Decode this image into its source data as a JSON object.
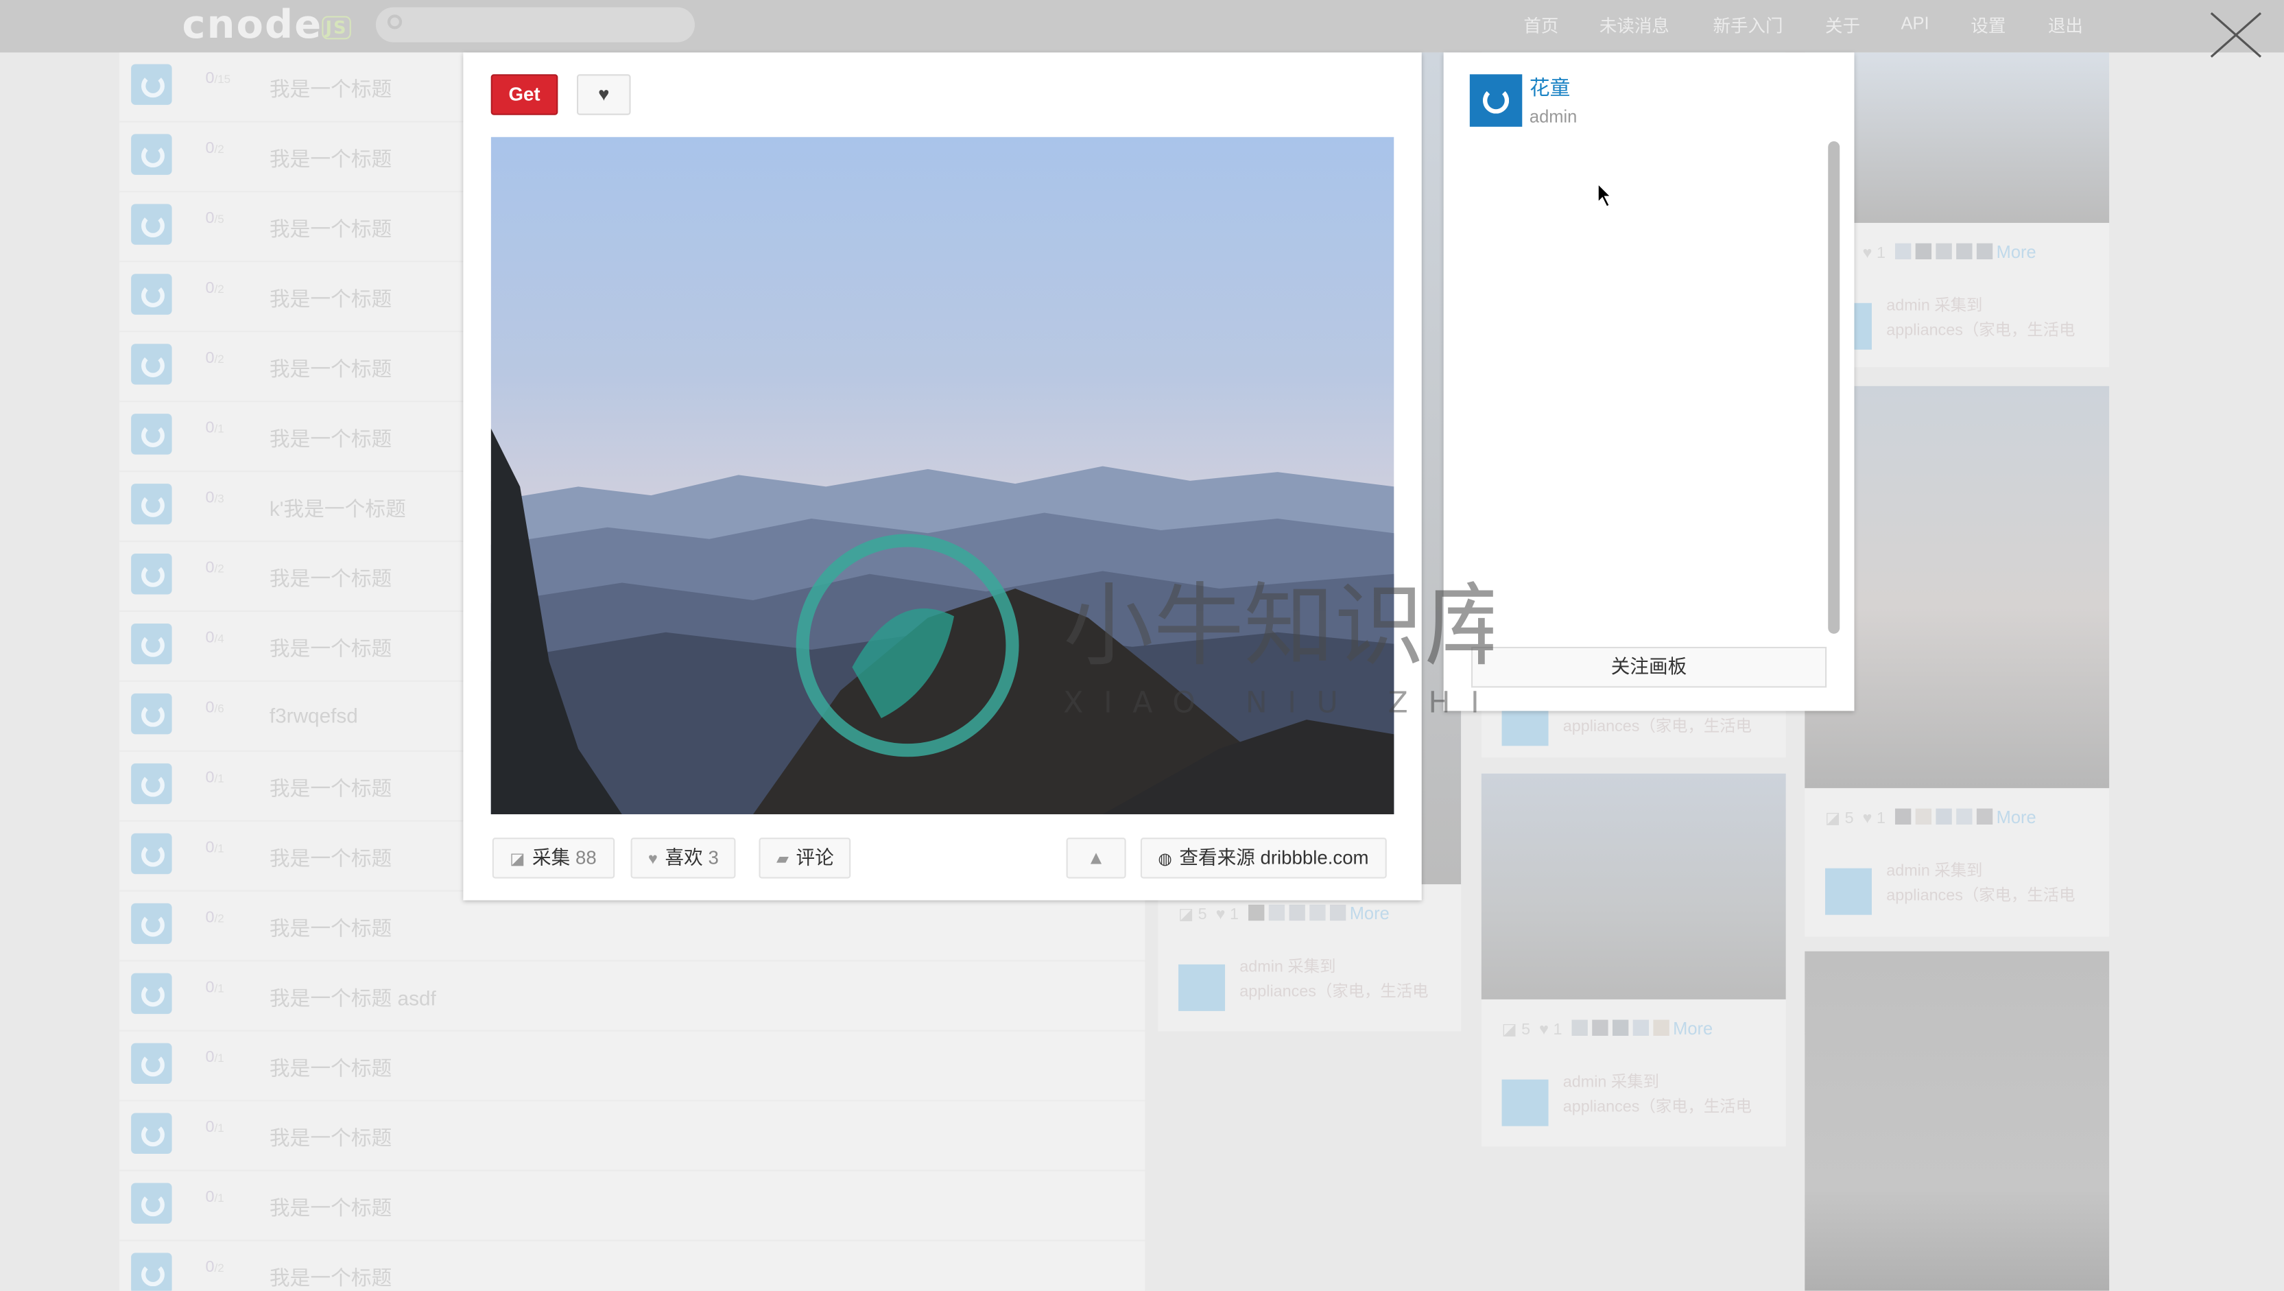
{
  "header": {
    "logo": "cnode",
    "logo_badge": "JS",
    "search_placeholder": "",
    "nav": [
      "首页",
      "未读消息",
      "新手入门",
      "关于",
      "API",
      "设置",
      "退出"
    ],
    "close_icon": "close-x-icon"
  },
  "topics": [
    {
      "replies": "0",
      "visits": "15",
      "title": "我是一个标题"
    },
    {
      "replies": "0",
      "visits": "2",
      "title": "我是一个标题"
    },
    {
      "replies": "0",
      "visits": "5",
      "title": "我是一个标题"
    },
    {
      "replies": "0",
      "visits": "2",
      "title": "我是一个标题"
    },
    {
      "replies": "0",
      "visits": "2",
      "title": "我是一个标题"
    },
    {
      "replies": "0",
      "visits": "1",
      "title": "我是一个标题"
    },
    {
      "replies": "0",
      "visits": "3",
      "title": "k'我是一个标题"
    },
    {
      "replies": "0",
      "visits": "2",
      "title": "我是一个标题"
    },
    {
      "replies": "0",
      "visits": "4",
      "title": "我是一个标题"
    },
    {
      "replies": "0",
      "visits": "6",
      "title": "f3rwqefsd"
    },
    {
      "replies": "0",
      "visits": "1",
      "title": "我是一个标题"
    },
    {
      "replies": "0",
      "visits": "1",
      "title": "我是一个标题"
    },
    {
      "replies": "0",
      "visits": "2",
      "title": "我是一个标题"
    },
    {
      "replies": "0",
      "visits": "1",
      "title": "我是一个标题 asdf"
    },
    {
      "replies": "0",
      "visits": "1",
      "title": "我是一个标题"
    },
    {
      "replies": "0",
      "visits": "1",
      "title": "我是一个标题"
    },
    {
      "replies": "0",
      "visits": "1",
      "title": "我是一个标题"
    },
    {
      "replies": "0",
      "visits": "2",
      "title": "我是一个标题"
    }
  ],
  "pins": {
    "repins": "5",
    "likes": "1",
    "more": "More",
    "user_line": "admin 采集到",
    "board_line": "appliances（家电，生活电"
  },
  "modal": {
    "get_label": "Get",
    "like_icon": "heart-icon",
    "collect_label": "采集",
    "collect_count": "88",
    "like_label": "喜欢",
    "like_count": "3",
    "comment_label": "评论",
    "report_icon": "warning-icon",
    "source_label": "查看来源 dribbble.com"
  },
  "side": {
    "board_name": "花童",
    "owner": "admin",
    "follow_label": "关注画板"
  },
  "watermark": {
    "cn": "小牛知识库",
    "en": "XIAO NIU ZHI SHI KU"
  },
  "colors": {
    "accent_red": "#d9262f",
    "link_blue": "#1a82c4",
    "avatar_blue": "#1a7bbf"
  }
}
